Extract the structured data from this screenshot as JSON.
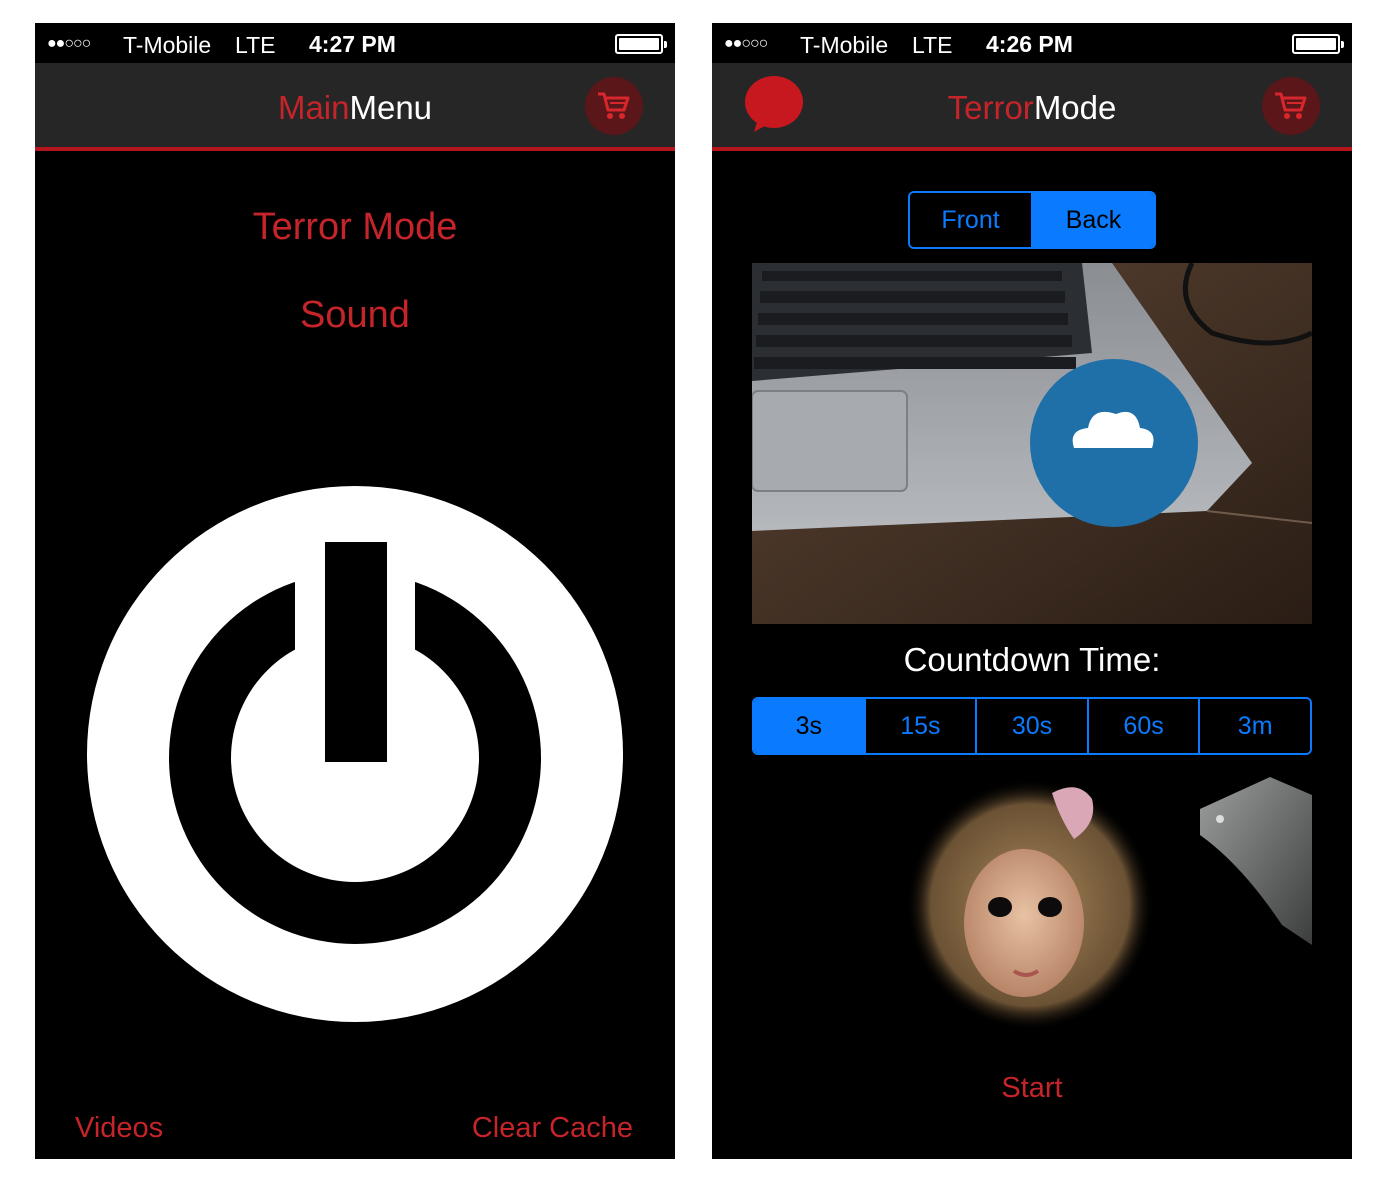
{
  "status_left": {
    "signal": "●●○○○",
    "carrier": "T-Mobile",
    "network": "LTE",
    "time": "4:27 PM"
  },
  "status_right": {
    "signal": "●●○○○",
    "carrier": "T-Mobile",
    "network": "LTE",
    "time": "4:26 PM"
  },
  "main_menu": {
    "title_part1": "Main",
    "title_part2": "Menu",
    "items": [
      "Terror Mode",
      "Sound"
    ],
    "power_icon": "power-icon",
    "cart_icon": "cart-icon",
    "videos_label": "Videos",
    "clear_cache_label": "Clear Cache"
  },
  "terror_mode": {
    "title_part1": "Terror",
    "title_part2": "Mode",
    "bubble_icon": "chat-bubble-icon",
    "cart_icon": "cart-icon",
    "camera_options": [
      "Front",
      "Back"
    ],
    "camera_selected": "Back",
    "countdown_label": "Countdown Time:",
    "countdown_options": [
      "3s",
      "15s",
      "30s",
      "60s",
      "3m"
    ],
    "countdown_selected": "3s",
    "start_label": "Start"
  },
  "colors": {
    "accent_red": "#c4242a",
    "ios_blue": "#0a7aff",
    "nav_bg": "#262626"
  }
}
